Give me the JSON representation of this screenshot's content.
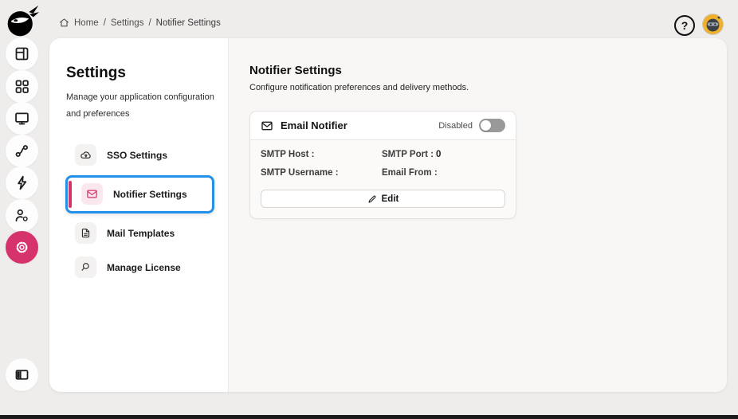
{
  "breadcrumb": {
    "separator": "/",
    "items": [
      "Home",
      "Settings",
      "Notifier Settings"
    ]
  },
  "topbar": {
    "help_glyph": "?"
  },
  "rail": {
    "icons": [
      "dashboard-layout",
      "apps-grid",
      "desktop-monitor",
      "route-branch",
      "lightning-bolt",
      "user-gear",
      "settings-gear",
      "panel-left"
    ],
    "active_icon": "settings-gear"
  },
  "settings_nav": {
    "title": "Settings",
    "subtitle": "Manage your application configuration and preferences",
    "items": [
      {
        "label": "SSO Settings",
        "icon": "cloud-lock-icon",
        "active": false
      },
      {
        "label": "Notifier Settings",
        "icon": "mail-icon",
        "active": true
      },
      {
        "label": "Mail Templates",
        "icon": "file-text-icon",
        "active": false
      },
      {
        "label": "Manage License",
        "icon": "magnifier-icon",
        "active": false
      }
    ]
  },
  "content": {
    "title": "Notifier Settings",
    "subtitle": "Configure notification preferences and delivery methods.",
    "card": {
      "title": "Email Notifier",
      "toggle_label": "Disabled",
      "toggle_state": "off",
      "fields": [
        {
          "label": "SMTP Host :",
          "value": ""
        },
        {
          "label": "SMTP Port :",
          "value": "0"
        },
        {
          "label": "SMTP Username :",
          "value": ""
        },
        {
          "label": "Email From :",
          "value": ""
        }
      ],
      "edit_label": "Edit"
    }
  },
  "colors": {
    "accent_pink": "#d6336c",
    "accent_pink_soft": "#fbe7ee",
    "focus_blue": "#2590e9",
    "page_bg": "#efedec",
    "panel_bg": "#ffffff",
    "content_bg": "#f8f7f6",
    "toggle_off": "#999999",
    "avatar_bg": "#efb02c"
  }
}
